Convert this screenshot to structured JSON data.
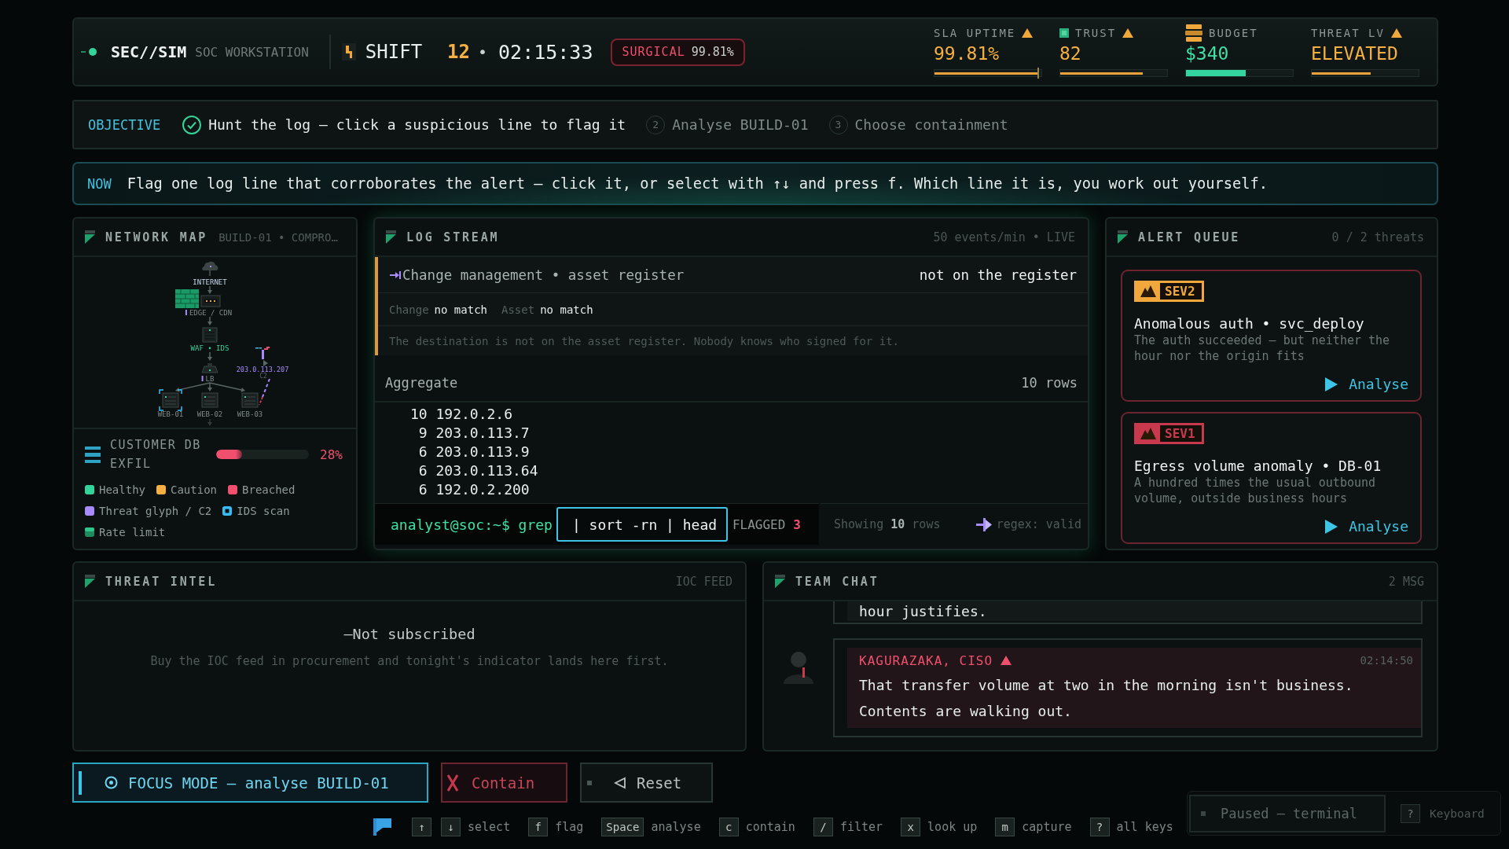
{
  "header": {
    "brand": "SEC//SIM",
    "product": "SOC WORKSTATION",
    "shift_label": "SHIFT",
    "shift_number": "12",
    "separator": "•",
    "clock": "02:15:33",
    "badge": {
      "label": "SURGICAL",
      "value": "99.81%"
    },
    "stats": [
      {
        "kind": "uptime",
        "label": "SLA UPTIME",
        "warning": true,
        "value": "99.81%",
        "level": 0.97
      },
      {
        "kind": "trust",
        "label": "TRUST",
        "warning": true,
        "value": "82",
        "level": 0.77
      },
      {
        "kind": "budget",
        "label": "BUDGET",
        "warning": false,
        "value": "$340",
        "level": 0.56
      },
      {
        "kind": "threat",
        "label": "THREAT LV",
        "warning": true,
        "value": "ELEVATED",
        "level": 0.55
      }
    ]
  },
  "objective": {
    "label": "OBJECTIVE",
    "steps": [
      {
        "done": true,
        "label": "Hunt the log — click a suspicious line to flag it"
      },
      {
        "done": false,
        "number": "2",
        "label": "Analyse BUILD-01"
      },
      {
        "done": false,
        "number": "3",
        "label": "Choose containment"
      }
    ]
  },
  "now": {
    "label": "NOW",
    "text": "Flag one log line that corroborates the alert — click it, or select with ↑↓ and press f. Which line it is, you work out yourself."
  },
  "network_map": {
    "title": "NETWORK MAP",
    "subtitle": "BUILD-01 • COMPRO…",
    "nodes": [
      {
        "kind": "cloud",
        "label": "INTERNET",
        "threat": false,
        "scanned": false
      },
      {
        "kind": "edge",
        "label": "EDGE / CDN",
        "threat": true,
        "scanned": false
      },
      {
        "kind": "waf",
        "label": "WAF • IDS",
        "threat": false,
        "scanned": false
      },
      {
        "kind": "lb",
        "label": "LB",
        "threat": true,
        "scanned": false
      },
      {
        "kind": "server",
        "label": "WEB-01",
        "threat": false,
        "scanned": true
      },
      {
        "kind": "server",
        "label": "WEB-02",
        "threat": false,
        "scanned": false
      },
      {
        "kind": "server",
        "label": "WEB-03",
        "threat": false,
        "scanned": false
      },
      {
        "kind": "c2",
        "label": "203.0.113.207",
        "sublabel": "C2",
        "threat": false,
        "scanned": false
      }
    ],
    "exfil": {
      "label": "CUSTOMER DB EXFIL",
      "level": 0.28,
      "reading": "28%"
    },
    "legend": [
      {
        "kind": "solid",
        "label": "Healthy",
        "color": "#34d399"
      },
      {
        "kind": "solid",
        "label": "Caution",
        "color": "#f5b041"
      },
      {
        "kind": "solid",
        "label": "Breached",
        "color": "#f0506e"
      },
      {
        "kind": "solid",
        "label": "Threat glyph / C2",
        "color": "#a78bfa"
      },
      {
        "kind": "scan",
        "label": "IDS scan",
        "color": "#38bdf8"
      },
      {
        "kind": "limit",
        "label": "Rate limit",
        "color": "#1f8a5f"
      }
    ]
  },
  "log_stream": {
    "title": "LOG STREAM",
    "meta": "50 events/min • LIVE",
    "detail": {
      "heading": "Change management • asset register",
      "verdict": "not on the register",
      "fields": [
        {
          "name": "Change",
          "value": "no match"
        },
        {
          "name": "Asset",
          "value": "no match"
        }
      ],
      "note": "The destination is not on the asset register. Nobody knows who signed for it."
    },
    "aggregate": {
      "title": "Aggregate",
      "count": "10 rows",
      "rows": [
        {
          "count": "10",
          "address": "192.0.2.6"
        },
        {
          "count": "9",
          "address": "203.0.113.7"
        },
        {
          "count": "6",
          "address": "203.0.113.9"
        },
        {
          "count": "6",
          "address": "203.0.113.64"
        },
        {
          "count": "6",
          "address": "192.0.2.200"
        }
      ]
    },
    "terminal": {
      "prompt": "analyst@soc:~$ grep",
      "input": "| sort -rn | head",
      "flagged_label": "FLAGGED",
      "flagged_count": "3",
      "showing": "Showing **10** rows",
      "regex": "regex: valid"
    }
  },
  "alert_queue": {
    "title": "ALERT QUEUE",
    "meta": "0 / 2 threats",
    "alerts": [
      {
        "severity": "SEV2",
        "color": "#f0a83c",
        "title": "Anomalous auth • svc_deploy",
        "description": "The auth succeeded — but neither the hour nor the origin fits",
        "action": "Analyse"
      },
      {
        "severity": "SEV1",
        "color": "#c8394e",
        "title": "Egress volume anomaly • DB-01",
        "description": "A hundred times the usual outbound volume, outside business hours",
        "action": "Analyse"
      }
    ]
  },
  "threat_intel": {
    "title": "THREAT INTEL",
    "meta": "IOC FEED",
    "status": "—Not subscribed",
    "description": "Buy the IOC feed in procurement and tonight's indicator lands here first."
  },
  "team_chat": {
    "title": "TEAM CHAT",
    "meta": "2 MSG",
    "messages": [
      {
        "alert": false,
        "text": "hour justifies."
      },
      {
        "author": "KAGURAZAKA, CISO",
        "alert": true,
        "time": "02:14:50",
        "text": "That transfer volume at two in the morning isn't business. Contents are walking out."
      }
    ]
  },
  "actions": [
    {
      "kind": "focus",
      "label": "FOCUS MODE — analyse BUILD-01"
    },
    {
      "kind": "contain",
      "label": "Contain"
    },
    {
      "kind": "reset",
      "label": "Reset"
    }
  ],
  "hints": [
    {
      "keys": [
        "↑",
        "↓"
      ],
      "label": "select"
    },
    {
      "keys": [
        "f"
      ],
      "label": "flag"
    },
    {
      "keys": [
        "Space"
      ],
      "label": "analyse"
    },
    {
      "keys": [
        "c"
      ],
      "label": "contain"
    },
    {
      "keys": [
        "/"
      ],
      "label": "filter"
    },
    {
      "keys": [
        "x"
      ],
      "label": "look up"
    },
    {
      "keys": [
        "m"
      ],
      "label": "capture"
    },
    {
      "keys": [
        "?"
      ],
      "label": "all keys"
    }
  ],
  "status": {
    "paused": "Paused — terminal",
    "keyboard_key": "?",
    "keyboard_label": "Keyboard"
  }
}
